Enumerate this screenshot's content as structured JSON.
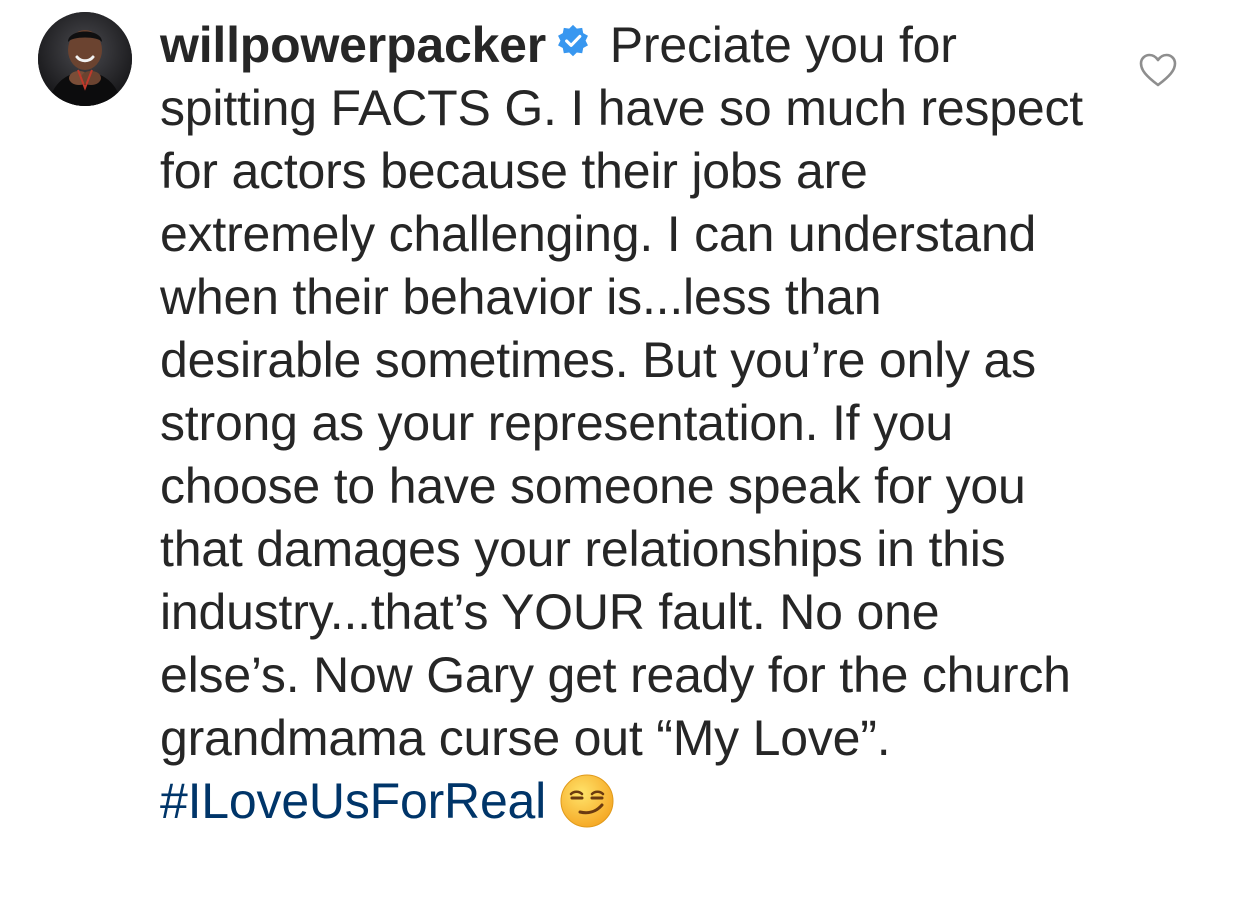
{
  "comment": {
    "username": "willpowerpacker",
    "verified": true,
    "verified_icon": "verified-badge-icon",
    "text": "Preciate you for spitting FACTS G. I have so much respect for actors because their jobs are extremely challenging. I can understand when their behavior is...less than desirable sometimes. But you’re only as strong as your representation. If you choose to have someone speak for you that damages your relationships in this industry...that’s YOUR fault. No one else’s. Now Gary get ready for the church grandmama curse out “My Love”.",
    "hashtag": "#ILoveUsForReal",
    "emoji_icon": "smirking-face-emoji",
    "like_icon": "heart-outline-icon"
  },
  "colors": {
    "text": "#262626",
    "hashtag": "#003569",
    "verified": "#3897f0",
    "like_outline": "#8e8e8e"
  }
}
